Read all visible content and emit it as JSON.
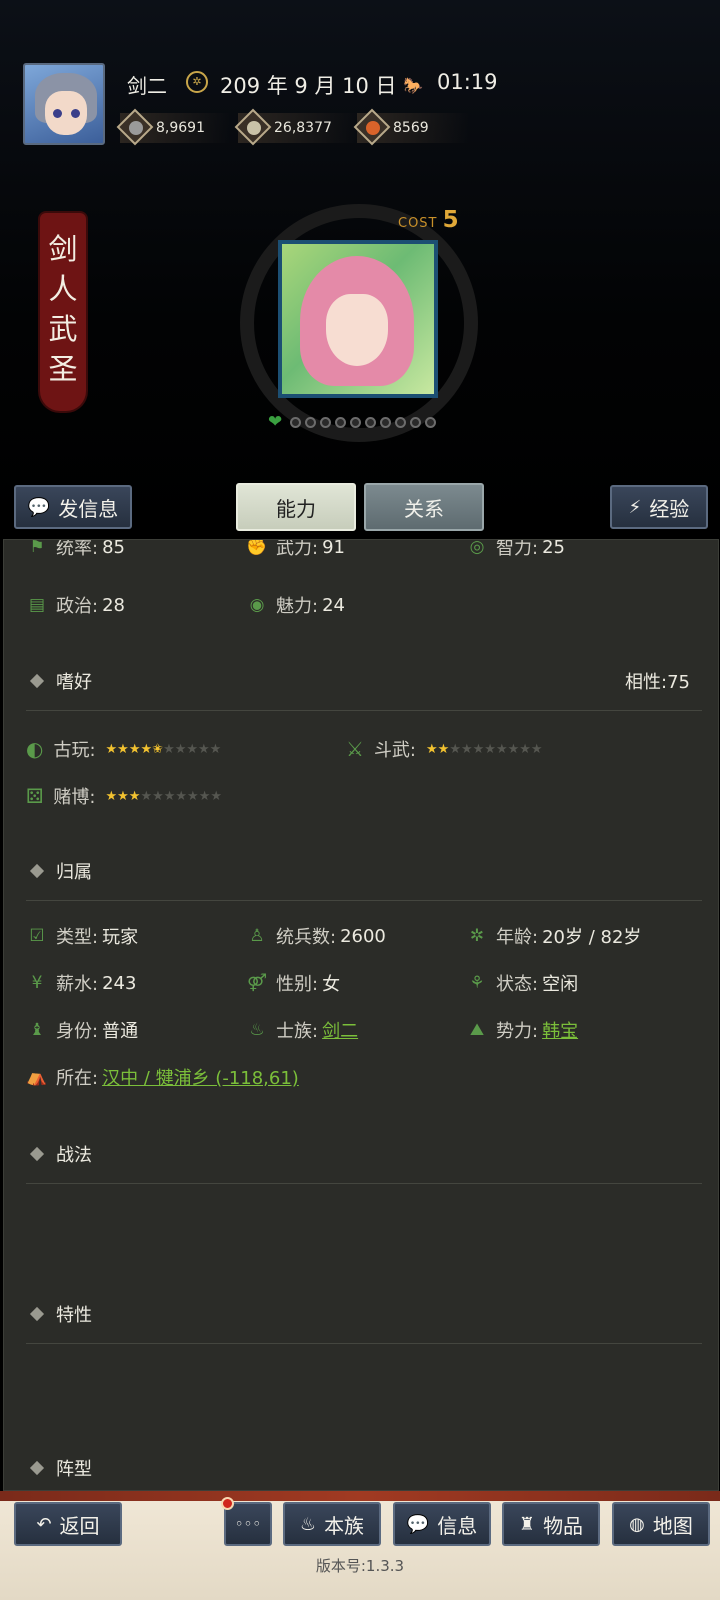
{
  "header": {
    "player_name": "剑二",
    "date": "209 年 9 月 10 日",
    "time": "01:19",
    "resources": [
      {
        "icon": "coin-icon",
        "value": "8,9691"
      },
      {
        "icon": "grain-icon",
        "value": "26,8377"
      },
      {
        "icon": "food-icon",
        "value": "8569"
      }
    ]
  },
  "character": {
    "title": [
      "剑",
      "人",
      "武",
      "圣"
    ],
    "cost_label": "COST",
    "cost_value": "5",
    "loyalty_dots": 10
  },
  "actions": {
    "send_message": "发信息",
    "tab_ability": "能力",
    "tab_relations": "关系",
    "experience": "经验"
  },
  "stats": {
    "leadership": {
      "label": "统率:",
      "value": "85"
    },
    "force": {
      "label": "武力:",
      "value": "91"
    },
    "intellect": {
      "label": "智力:",
      "value": "25"
    },
    "politics": {
      "label": "政治:",
      "value": "28"
    },
    "charm": {
      "label": "魅力:",
      "value": "24"
    }
  },
  "hobbies": {
    "heading": "嗜好",
    "affinity": "相性:75",
    "items": [
      {
        "label": "古玩:",
        "stars": 4.5
      },
      {
        "label": "斗武:",
        "stars": 2
      },
      {
        "label": "赌博:",
        "stars": 3
      }
    ],
    "max_stars": 10
  },
  "belonging": {
    "heading": "归属",
    "type": {
      "label": "类型:",
      "value": "玩家"
    },
    "troops": {
      "label": "统兵数:",
      "value": "2600"
    },
    "age": {
      "label": "年龄:",
      "value": "20岁 / 82岁"
    },
    "salary": {
      "label": "薪水:",
      "value": "243"
    },
    "gender": {
      "label": "性别:",
      "value": "女"
    },
    "status": {
      "label": "状态:",
      "value": "空闲"
    },
    "identity": {
      "label": "身份:",
      "value": "普通"
    },
    "clan": {
      "label": "士族:",
      "value": "剑二"
    },
    "faction": {
      "label": "势力:",
      "value": "韩宝"
    },
    "location": {
      "label": "所在:",
      "value": "汉中 / 犍浦乡 (-118,61)"
    }
  },
  "sections": {
    "tactics": "战法",
    "traits": "特性",
    "formation": "阵型"
  },
  "footer": {
    "back": "返回",
    "more": "◦◦◦",
    "clan": "本族",
    "info": "信息",
    "items": "物品",
    "map": "地图",
    "version": "版本号:1.3.3"
  },
  "colors": {
    "accent_green": "#7bbf3a",
    "star_gold": "#f2c230",
    "banner_red": "#6e1414",
    "button_blue": "#2e3a4c"
  }
}
